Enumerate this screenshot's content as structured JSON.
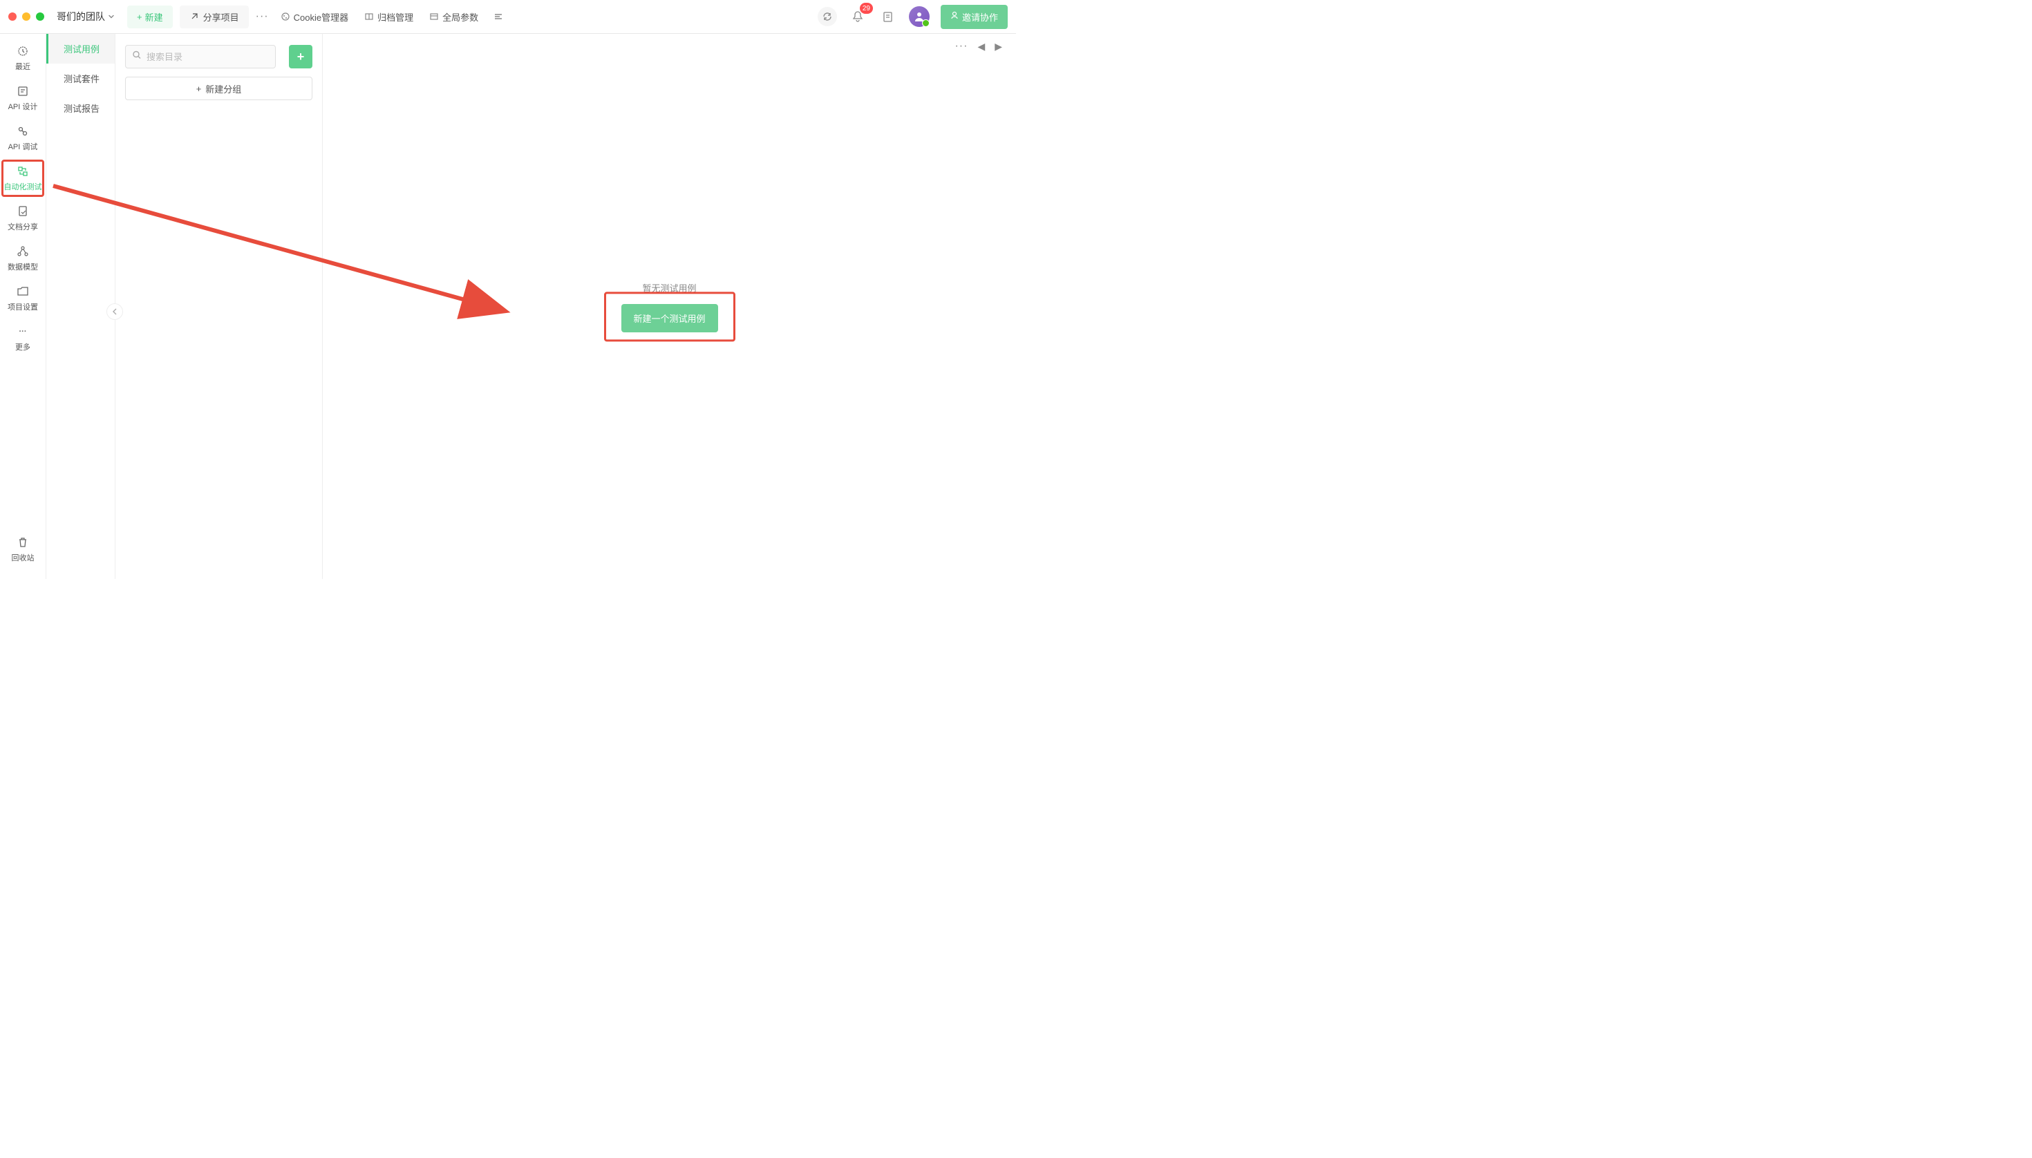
{
  "titlebar": {
    "team_name": "哥们的团队",
    "new_button": "新建",
    "share_button": "分享项目",
    "cookie_mgr": "Cookie管理器",
    "archive_mgr": "归档管理",
    "global_params": "全局参数",
    "invite_button": "邀请协作",
    "notification_count": "29"
  },
  "sidebar": {
    "items": [
      {
        "label": "最近"
      },
      {
        "label": "API 设计"
      },
      {
        "label": "API 调试"
      },
      {
        "label": "自动化测试"
      },
      {
        "label": "文档分享"
      },
      {
        "label": "数据模型"
      },
      {
        "label": "项目设置"
      },
      {
        "label": "更多"
      }
    ],
    "bottom_label": "回收站"
  },
  "subpanel": {
    "tabs": [
      {
        "label": "测试用例"
      },
      {
        "label": "测试套件"
      },
      {
        "label": "测试报告"
      }
    ]
  },
  "tree": {
    "search_placeholder": "搜索目录",
    "new_group": "新建分组"
  },
  "content": {
    "empty_text": "暂无测试用例",
    "create_button": "新建一个测试用例"
  }
}
